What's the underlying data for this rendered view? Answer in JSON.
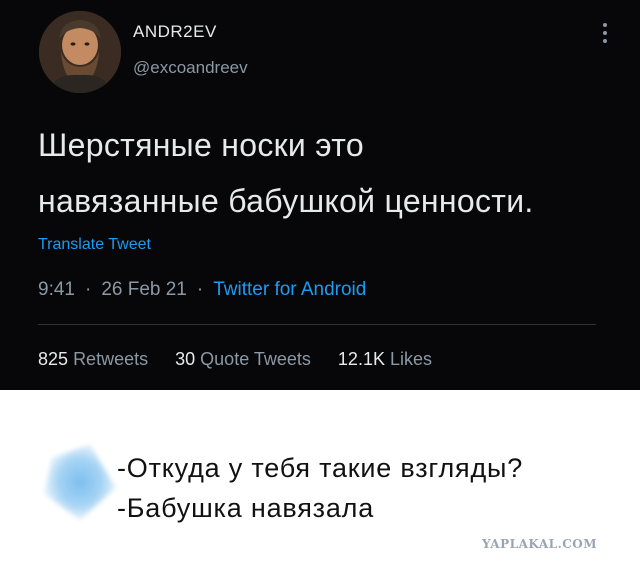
{
  "tweet": {
    "author": {
      "name": "ANDR2EV",
      "handle": "@excoandreev",
      "avatar_icon": "bearded-man-avatar"
    },
    "more_icon": "vertical-ellipsis-icon",
    "text_lines": [
      "Шерстяные носки это",
      "навязанные бабушкой ценности."
    ],
    "translate_label": "Translate Tweet",
    "time": "9:41",
    "date": "26 Feb 21",
    "source": "Twitter for Android",
    "separator": "·",
    "stats": {
      "retweets_count": "825",
      "retweets_label": "Retweets",
      "quotes_count": "30",
      "quotes_label": "Quote Tweets",
      "likes_count": "12.1K",
      "likes_label": "Likes"
    },
    "colors": {
      "background": "#070709",
      "text": "#e7e9ea",
      "muted": "#8b98a5",
      "link": "#1d9bf0"
    }
  },
  "caption": {
    "lines": [
      "-Откуда у тебя такие взгляды?",
      "-Бабушка навязала"
    ],
    "icon": "blue-diamond-icon"
  },
  "watermark": "YAPLAKAL.COM"
}
